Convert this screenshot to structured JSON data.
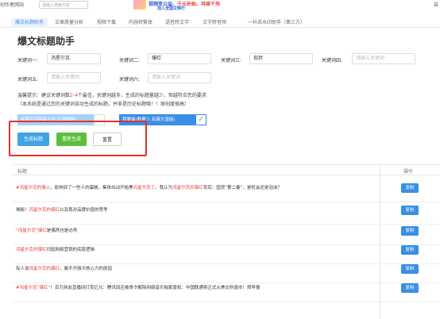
{
  "topbar": {
    "app_title": "创作者网站",
    "search_placeholder": "请输入搜索内容",
    "banner_line1_a": "视频变公益、",
    "banner_line1_b": "千元补贴、持续千场",
    "banner_line2": "加入全国文明行",
    "right_text": "自"
  },
  "tabs": [
    {
      "label": "爆文标题助手"
    },
    {
      "label": "文章质量分析"
    },
    {
      "label": "视频下载"
    },
    {
      "label": "内容转繁体"
    },
    {
      "label": "语音转文字"
    },
    {
      "label": "文字转音频"
    },
    {
      "label": "一抖去水印助手（第三方）"
    }
  ],
  "page_title": "爆文标题助手",
  "keywords": [
    {
      "label": "关键词一:",
      "value": "鸿星尔克",
      "placeholder": ""
    },
    {
      "label": "关键词二:",
      "value": "爆红",
      "placeholder": ""
    },
    {
      "label": "关键词三:",
      "value": "现状",
      "placeholder": ""
    },
    {
      "label": "关键词四:",
      "value": "",
      "placeholder": "请输入关键词"
    },
    {
      "label": "关键词五:",
      "value": "",
      "placeholder": "请输入关键词"
    },
    {
      "label": "关键词六:",
      "value": "",
      "placeholder": "请输入关键词"
    }
  ],
  "note1_a": "温馨提示：建议关键词数",
  "note1_red": "2-4",
  "note1_b": "个最佳，关键词越多，生成的标题量越少，但越符合您的要求",
  "note2": "（本系统是通过您的关键词自动生成的标题，并非是历史标题哦！！原创度很高）",
  "options": [
    {
      "label": "标题可读性最大化(文读顺畅)",
      "checked": false
    },
    {
      "label": "我要最(数量少,有爆文潜能)",
      "checked": true
    }
  ],
  "check_mark": "✓",
  "actions": {
    "generate": "生成标题",
    "regenerate": "重新生成",
    "reset": "重置"
  },
  "table": {
    "col_title": "标题",
    "col_op": "操作",
    "copy_label": "复制",
    "rows": [
      {
        "a": "#",
        "b": "鸿星尔克的爆火",
        "c": "，影响到了一些人的蛋糕，集体出动开始黑",
        "d": "鸿星尔克了",
        "e": "。我认为",
        "f": "鸿星尔克的爆红",
        "g": "背后：国货“第二春”，是机会还是泡沫？"
      },
      {
        "a": "揭秘！",
        "b": "鸿星尔克的爆红",
        "c": "以及我对品牌价值的思考",
        "d": "",
        "e": "",
        "f": "",
        "g": ""
      },
      {
        "a": "“",
        "b": "鸿星尔克",
        "c": "”",
        "d": "爆红",
        "e": "是偶然也是必然",
        "f": "",
        "g": ""
      },
      {
        "a": "",
        "b": "鸿星尔克的爆红",
        "c": "归因网络营销的底层逻辑",
        "d": "",
        "e": "",
        "f": "",
        "g": ""
      },
      {
        "a": "有人说",
        "b": "鸿星尔克的爆红",
        "c": "，离不开强大核心力的原因",
        "d": "",
        "e": "",
        "f": "",
        "g": ""
      },
      {
        "a": "#",
        "b": "鸿星尔克“爆红”",
        "c": "！百万网友直播间打赏亿元：腾讯回应被责令解除网络音乐独家版权：中国联通将正式从美交所退市！郑早报",
        "d": "",
        "e": "",
        "f": "",
        "g": ""
      }
    ]
  },
  "colors": {
    "accent": "#3a8ee6",
    "highlight": "#e52e2e",
    "keyword": "#e8433a",
    "green": "#5bbf3c"
  }
}
